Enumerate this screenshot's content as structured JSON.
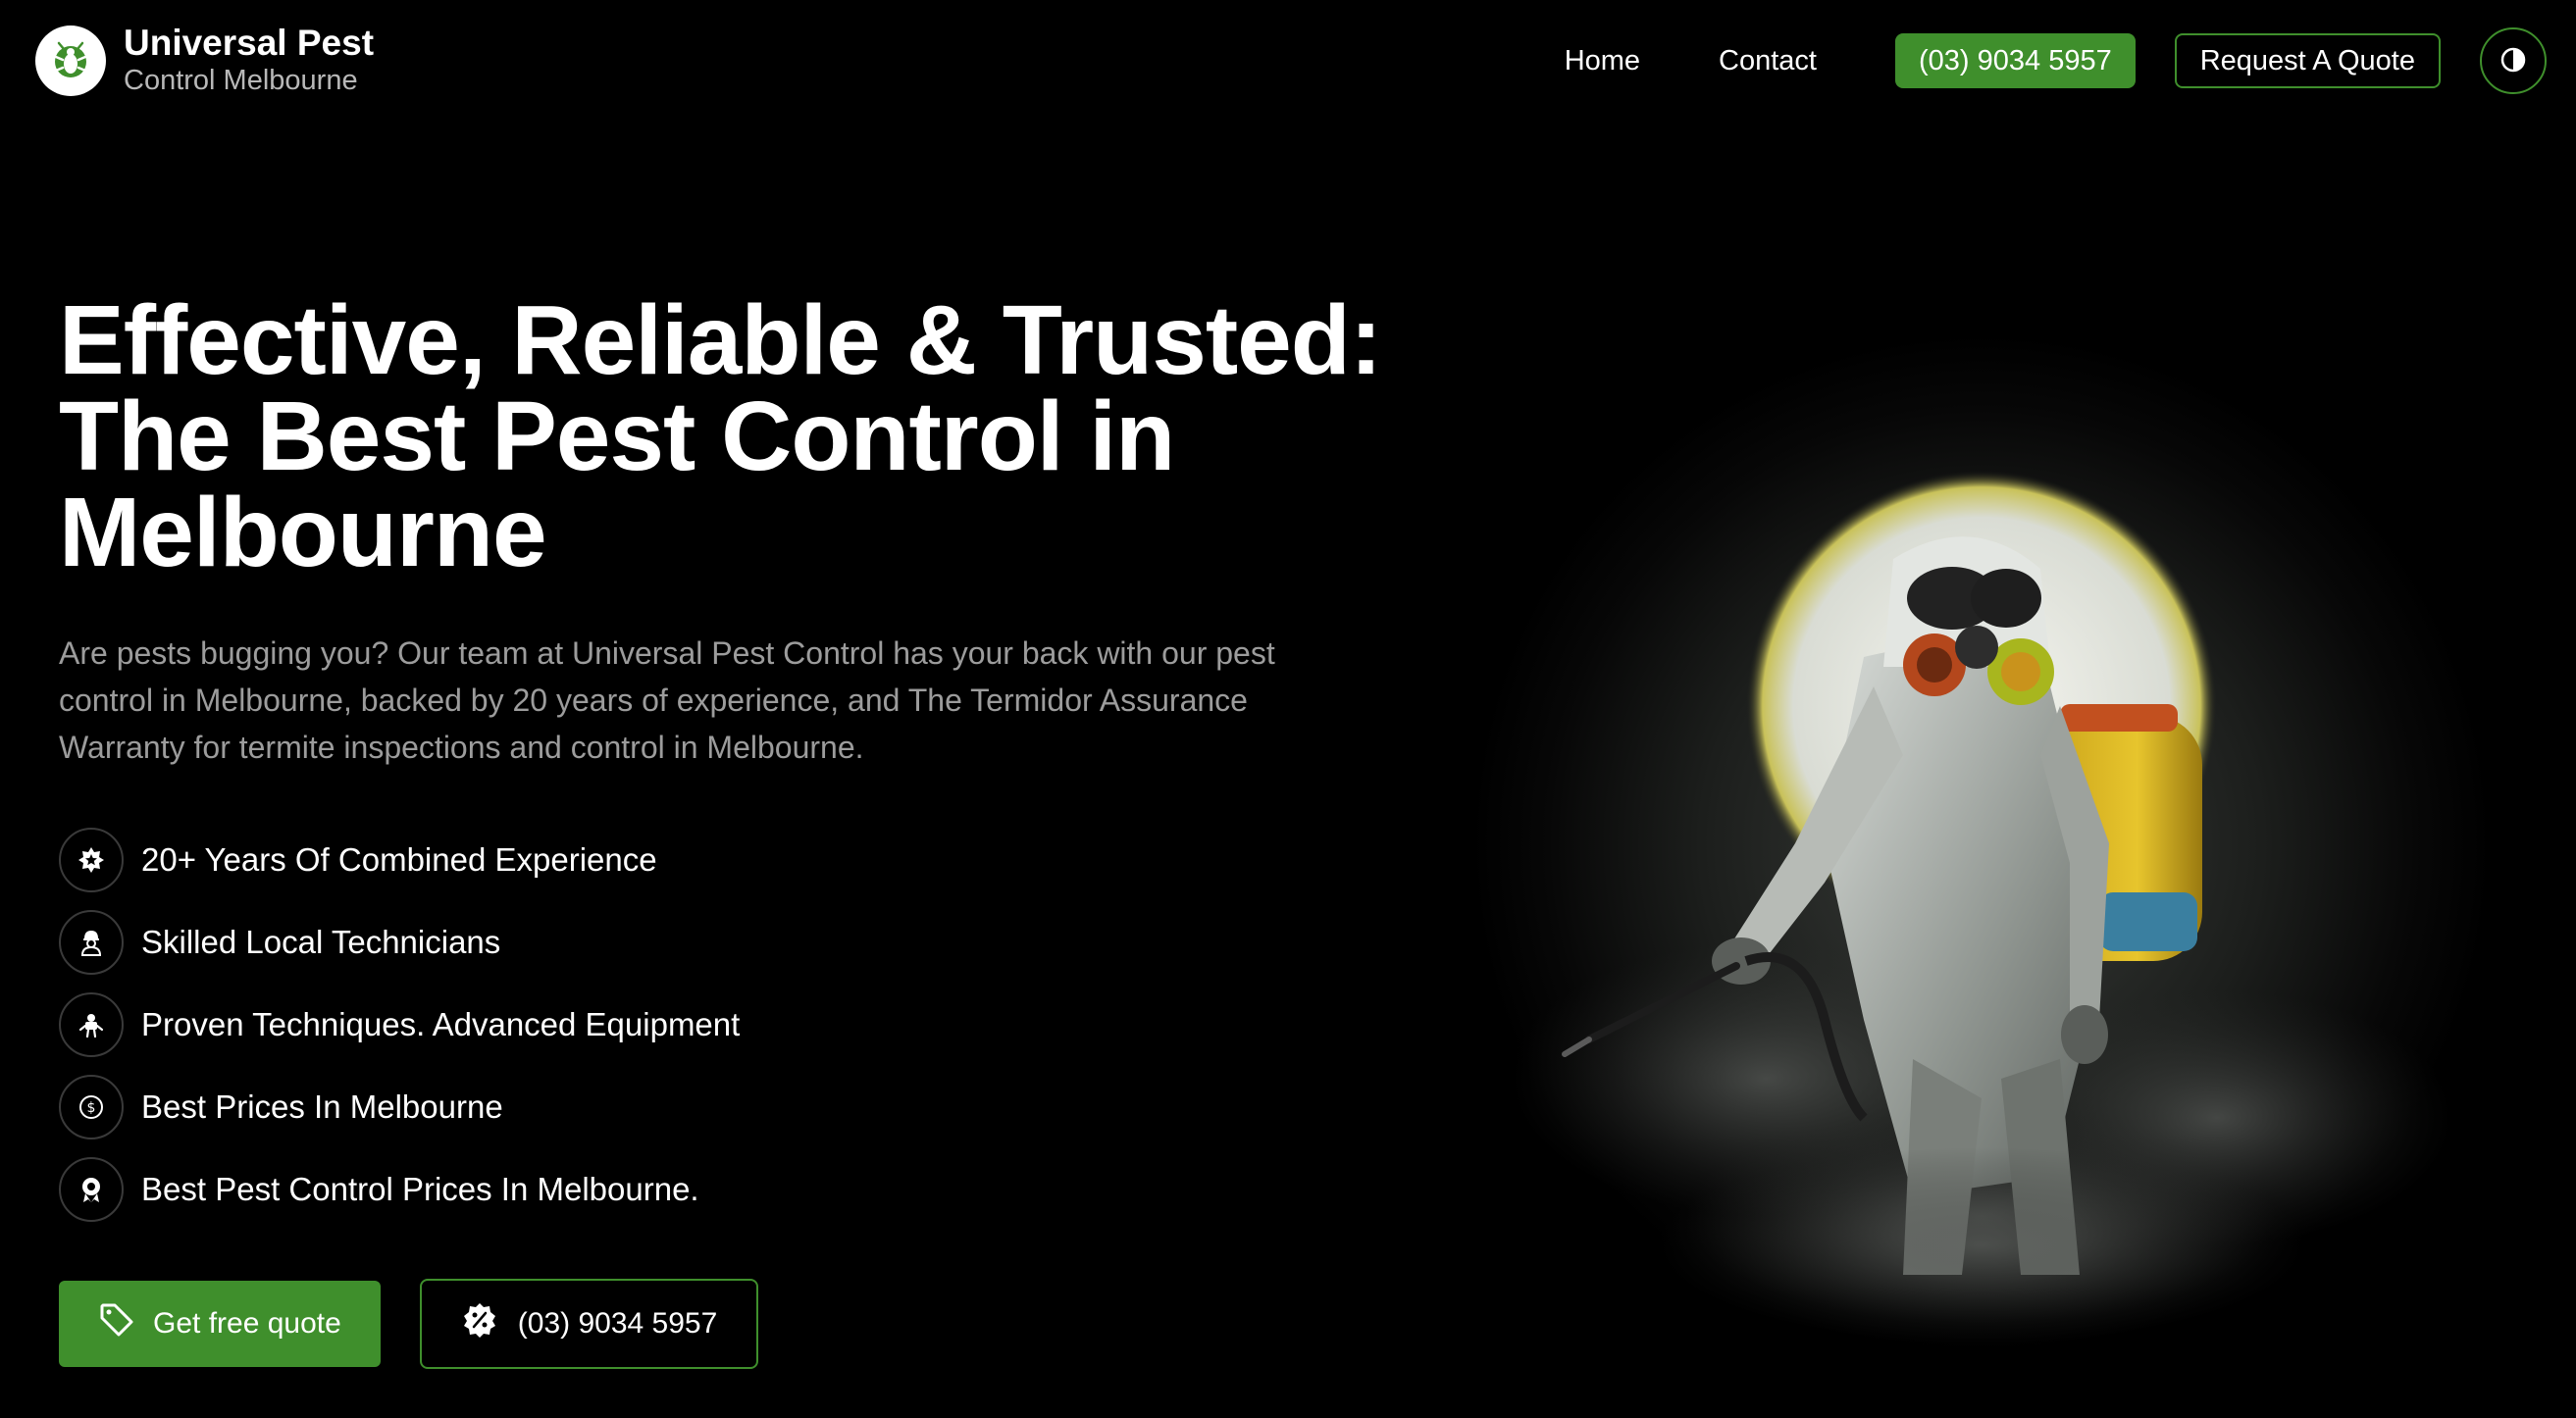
{
  "brand": {
    "title": "Universal Pest",
    "subtitle": "Control Melbourne"
  },
  "nav": {
    "home": "Home",
    "contact": "Contact",
    "phone": "(03) 9034 5957",
    "quote": "Request A Quote"
  },
  "hero": {
    "title": "Effective, Reliable & Trusted: The Best Pest Control in Melbourne",
    "description": "Are pests bugging you? Our team at Universal Pest Control has your back with our pest control in Melbourne, backed by 20 years of experience, and The Termidor Assurance Warranty for termite inspections and control in Melbourne.",
    "features": [
      {
        "icon": "badge-star-icon",
        "label": "20+ Years Of Combined Experience"
      },
      {
        "icon": "technician-icon",
        "label": "Skilled Local Technicians"
      },
      {
        "icon": "equipment-icon",
        "label": "Proven Techniques. Advanced Equipment"
      },
      {
        "icon": "dollar-icon",
        "label": "Best Prices In Melbourne"
      },
      {
        "icon": "award-icon",
        "label": "Best Pest Control Prices In Melbourne."
      }
    ],
    "cta_primary": "Get free quote",
    "cta_phone": "(03) 9034 5957"
  },
  "colors": {
    "accent": "#3f8f2c",
    "background": "#000000",
    "muted_text": "#9c9c9c"
  }
}
